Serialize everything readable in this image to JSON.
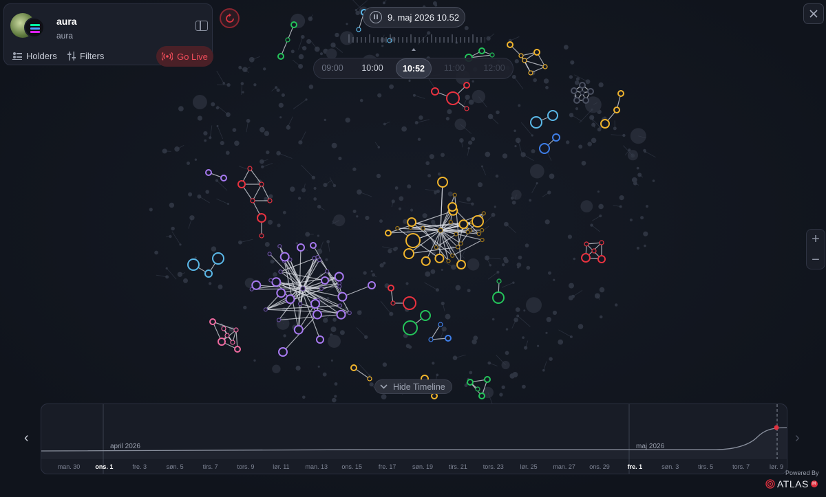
{
  "token": {
    "name": "aura",
    "symbol": "aura"
  },
  "card_actions": {
    "holders_label": "Holders",
    "filters_label": "Filters",
    "go_live_label": "Go Live"
  },
  "playback": {
    "current_datetime": "9. maj 2026 10.52",
    "hours": [
      "09:00",
      "10:00",
      "10:52",
      "11:00",
      "12:00"
    ],
    "active_hour": "10:52"
  },
  "controls": {
    "hide_timeline_label": "Hide Timeline",
    "zoom_in": "+",
    "zoom_out": "−"
  },
  "timeline": {
    "months": [
      "april 2026",
      "maj 2026"
    ],
    "ticks": [
      "man. 30",
      "ons. 1",
      "fre. 3",
      "søn. 5",
      "tirs. 7",
      "tors. 9",
      "lør. 11",
      "man. 13",
      "ons. 15",
      "fre. 17",
      "søn. 19",
      "tirs. 21",
      "tors. 23",
      "lør. 25",
      "man. 27",
      "ons. 29",
      "fre. 1",
      "søn. 3",
      "tirs. 5",
      "tors. 7",
      "lør. 9"
    ],
    "bold_ticks": [
      "ons. 1",
      "fre. 1"
    ]
  },
  "branding": {
    "powered_by": "Powered By",
    "name": "ATLAS",
    "badge": "M"
  },
  "colors": {
    "background": "#121620",
    "yellow": "#f1b52c",
    "purple": "#a779f0",
    "red": "#e8323f",
    "green": "#24c45a",
    "cyan": "#5ab8e8",
    "blue": "#3e7ee8",
    "pink": "#f06aa0",
    "live_red": "#f04d5a"
  }
}
